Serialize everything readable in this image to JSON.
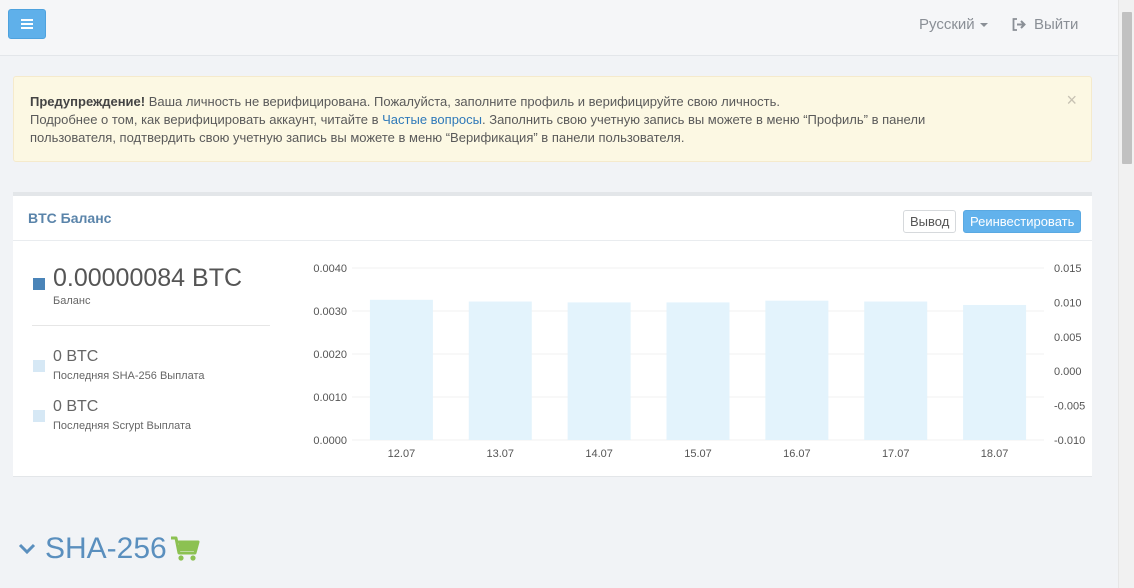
{
  "header": {
    "menu_icon": "hamburger-icon",
    "language": "Русский",
    "logout": "Выйти",
    "logout_icon": "sign-out-icon"
  },
  "alert": {
    "strong": "Предупреждение!",
    "line1": " Ваша личность не верифицирована. Пожалуйста, заполните профиль и верифицируйте свою личность.",
    "line2_pre": "Подробнее о том, как верифицировать аккаунт, читайте в ",
    "link": "Частые вопросы",
    "line2_post": ". Заполнить свою учетную запись вы можете в меню “Профиль” в панели",
    "line3": "пользователя, подтвердить свою учетную запись вы можете в меню “Верификация” в панели пользователя.",
    "close": "×"
  },
  "balance_panel": {
    "title": "BTC Баланс",
    "withdraw_label": "Вывод",
    "reinvest_label": "Реинвестировать",
    "balance": {
      "value": "0.00000084 BTC",
      "label": "Баланс",
      "color": "#4a84b8"
    },
    "sha256": {
      "value": "0 BTC",
      "label": "Последняя SHA-256 Выплата",
      "color": "#d6e8f5"
    },
    "scrypt": {
      "value": "0 BTC",
      "label": "Последняя Scrypt Выплата",
      "color": "#d6e8f5"
    }
  },
  "chart_data": {
    "type": "bar",
    "categories": [
      "12.07",
      "13.07",
      "14.07",
      "15.07",
      "16.07",
      "17.07",
      "18.07"
    ],
    "series": [
      {
        "values": [
          0.00326,
          0.00322,
          0.0032,
          0.0032,
          0.00324,
          0.00322,
          0.00314
        ],
        "color": "#e3f3fc"
      }
    ],
    "ylim": [
      0,
      0.004
    ],
    "yticks": [
      "0.0040",
      "0.0030",
      "0.0020",
      "0.0010",
      "0.0000"
    ],
    "y2lim": [
      -0.01,
      0.015
    ],
    "y2ticks": [
      "0.015",
      "0.010",
      "0.005",
      "0.000",
      "-0.005",
      "-0.010"
    ],
    "grid": true
  },
  "section": {
    "title": "SHA-256",
    "chevron_icon": "chevron-down-icon",
    "cart_icon": "shopping-cart-icon",
    "cart_color": "#8cc152"
  }
}
